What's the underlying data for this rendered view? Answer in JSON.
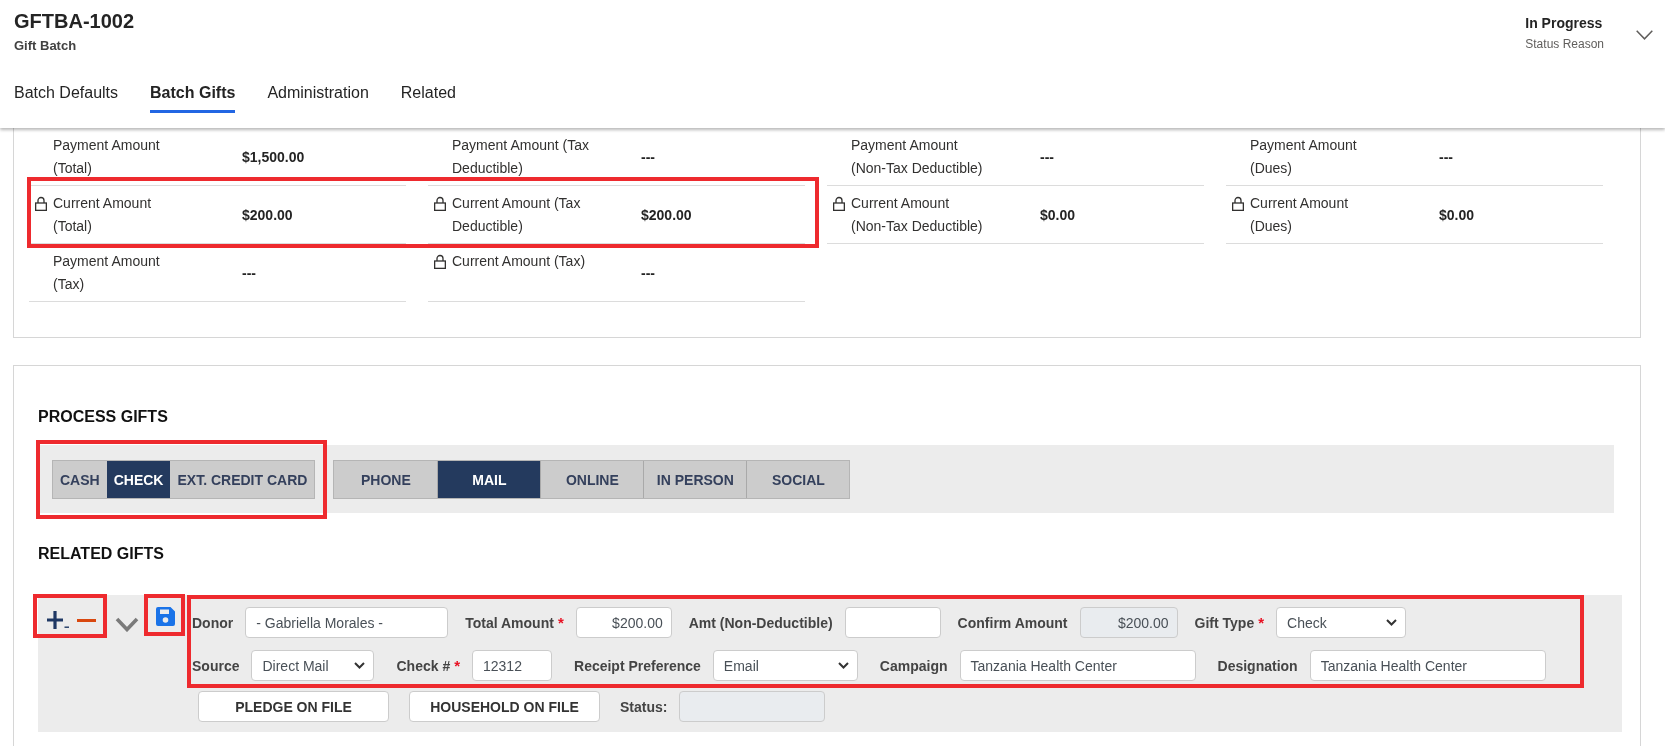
{
  "record": {
    "title": "GFTBA-1002",
    "subtitle": "Gift Batch"
  },
  "status": {
    "value": "In Progress",
    "label": "Status Reason"
  },
  "tabs": [
    {
      "label": "Batch Defaults",
      "selected": false
    },
    {
      "label": "Batch Gifts",
      "selected": true
    },
    {
      "label": "Administration",
      "selected": false
    },
    {
      "label": "Related",
      "selected": false
    }
  ],
  "summary": {
    "rows": [
      {
        "cells": [
          {
            "label": "Payment Amount (Total)",
            "value": "$1,500.00",
            "locked": false,
            "highlighted": false
          },
          {
            "label": "Payment Amount (Tax Deductible)",
            "value": "---",
            "locked": false,
            "highlighted": false
          },
          {
            "label": "Payment Amount (Non-Tax Deductible)",
            "value": "---",
            "locked": false,
            "highlighted": false
          },
          {
            "label": "Payment Amount (Dues)",
            "value": "---",
            "locked": false,
            "highlighted": false
          }
        ]
      },
      {
        "cells": [
          {
            "label": "Current Amount (Total)",
            "value": "$200.00",
            "locked": true,
            "highlighted": true
          },
          {
            "label": "Current Amount (Tax Deductible)",
            "value": "$200.00",
            "locked": true,
            "highlighted": true
          },
          {
            "label": "Current Amount (Non-Tax Deductible)",
            "value": "$0.00",
            "locked": true,
            "highlighted": false
          },
          {
            "label": "Current Amount (Dues)",
            "value": "$0.00",
            "locked": true,
            "highlighted": false
          }
        ]
      },
      {
        "cells": [
          {
            "label": "Payment Amount (Tax)",
            "value": "---",
            "locked": false,
            "highlighted": false
          },
          {
            "label": "Current Amount (Tax)",
            "value": "---",
            "locked": true,
            "highlighted": false
          }
        ]
      }
    ]
  },
  "process_gifts": {
    "title": "PROCESS GIFTS",
    "payment_methods": {
      "highlighted": true,
      "options": [
        {
          "label": "CASH",
          "selected": false
        },
        {
          "label": "CHECK",
          "selected": true
        },
        {
          "label": "EXT. CREDIT CARD",
          "selected": false
        }
      ]
    },
    "channels": {
      "options": [
        {
          "label": "PHONE",
          "selected": false
        },
        {
          "label": "MAIL",
          "selected": true
        },
        {
          "label": "ONLINE",
          "selected": false
        },
        {
          "label": "IN PERSON",
          "selected": false
        },
        {
          "label": "SOCIAL",
          "selected": false
        }
      ]
    }
  },
  "related_gifts": {
    "title": "RELATED GIFTS",
    "row_actions": {
      "highlighted": true
    },
    "save": {
      "highlighted": true
    },
    "fields": {
      "highlighted": true,
      "rows": [
        [
          {
            "label": "Donor",
            "kind": "text",
            "value": "- Gabriella Morales -",
            "disabled": false
          },
          {
            "label": "Total Amount",
            "required_mark": "*",
            "kind": "amount",
            "value": "$200.00",
            "disabled": false
          },
          {
            "label": "Amt (Non-Deductible)",
            "kind": "amount",
            "disabled": false
          },
          {
            "label": "Confirm Amount",
            "kind": "amount",
            "value": "$200.00",
            "disabled": true
          },
          {
            "label": "Gift Type",
            "required_mark": "*",
            "kind": "select",
            "value": "Check",
            "disabled": false
          }
        ],
        [
          {
            "label": "Source",
            "kind": "select",
            "value": "Direct Mail",
            "disabled": false
          },
          {
            "label": "Check #",
            "required_mark": "*",
            "kind": "text",
            "value": "12312",
            "disabled": false
          },
          {
            "label": "Receipt Preference",
            "kind": "select",
            "value": "Email",
            "disabled": false
          },
          {
            "label": "Campaign",
            "kind": "text",
            "value": "Tanzania Health Center",
            "disabled": false
          },
          {
            "label": "Designation",
            "kind": "text",
            "value": "Tanzania Health Center",
            "disabled": false
          }
        ]
      ]
    },
    "footer": [
      {
        "kind": "button",
        "label": "PLEDGE ON FILE"
      },
      {
        "kind": "button",
        "label": "HOUSEHOLD ON FILE"
      },
      {
        "kind": "text",
        "label": "Status:",
        "disabled": true
      }
    ]
  }
}
